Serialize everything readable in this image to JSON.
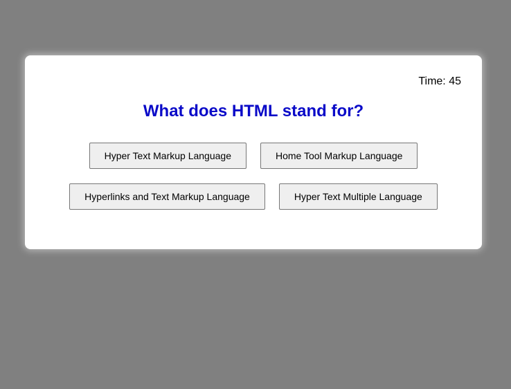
{
  "quiz": {
    "timer_label": "Time: 45",
    "question": "What does HTML stand for?",
    "options": [
      "Hyper Text Markup Language",
      "Home Tool Markup Language",
      "Hyperlinks and Text Markup Language",
      "Hyper Text Multiple Language"
    ]
  },
  "colors": {
    "page_background": "#808080",
    "card_background": "#ffffff",
    "question_color": "#0a0ac8",
    "button_background": "#efefef"
  }
}
